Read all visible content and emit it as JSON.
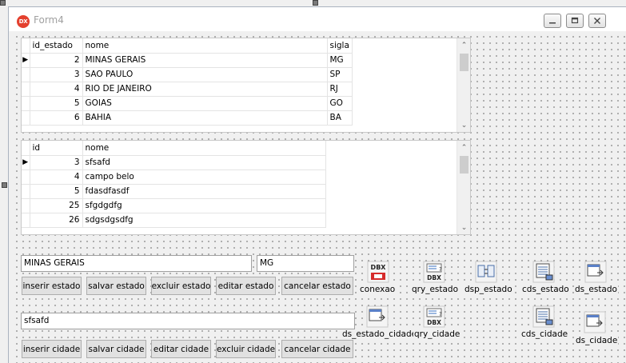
{
  "window": {
    "title": "Form4",
    "icon_text": "DX"
  },
  "grid_estado": {
    "columns": [
      "id_estado",
      "nome",
      "sigla"
    ],
    "rows": [
      [
        "2",
        "MINAS GERAIS",
        "MG"
      ],
      [
        "3",
        "SAO PAULO",
        "SP"
      ],
      [
        "4",
        "RIO DE JANEIRO",
        "RJ"
      ],
      [
        "5",
        "GOIAS",
        "GO"
      ],
      [
        "6",
        "BAHIA",
        "BA"
      ]
    ]
  },
  "grid_cidade": {
    "columns": [
      "id",
      "nome"
    ],
    "rows": [
      [
        "3",
        "sfsafd"
      ],
      [
        "4",
        "campo belo"
      ],
      [
        "5",
        "fdasdfasdf"
      ],
      [
        "25",
        "sfgdgdfg"
      ],
      [
        "26",
        "sdgsdgsdfg"
      ]
    ]
  },
  "estado_form": {
    "nome_value": "MINAS GERAIS",
    "sigla_value": "MG",
    "buttons": [
      "inserir estado",
      "salvar estado",
      "excluir estado",
      "editar estado",
      "cancelar estado"
    ]
  },
  "cidade_form": {
    "nome_value": "sfsafd",
    "buttons": [
      "inserir cidade",
      "salvar cidade",
      "editar cidade",
      "excluir cidade",
      "cancelar cidade"
    ]
  },
  "components": [
    {
      "label": "conexao",
      "icon": "dbx-connection-icon"
    },
    {
      "label": "qry_estado",
      "icon": "dbx-query-icon"
    },
    {
      "label": "dsp_estado",
      "icon": "dataset-provider-icon"
    },
    {
      "label": "cds_estado",
      "icon": "client-dataset-icon"
    },
    {
      "label": "ds_estado",
      "icon": "datasource-icon"
    },
    {
      "label": "ds_estado_cidade",
      "icon": "datasource-icon"
    },
    {
      "label": "qry_cidade",
      "icon": "dbx-query-icon"
    },
    {
      "label": "cds_cidade",
      "icon": "client-dataset-icon"
    },
    {
      "label": "ds_cidade",
      "icon": "datasource-icon"
    }
  ]
}
